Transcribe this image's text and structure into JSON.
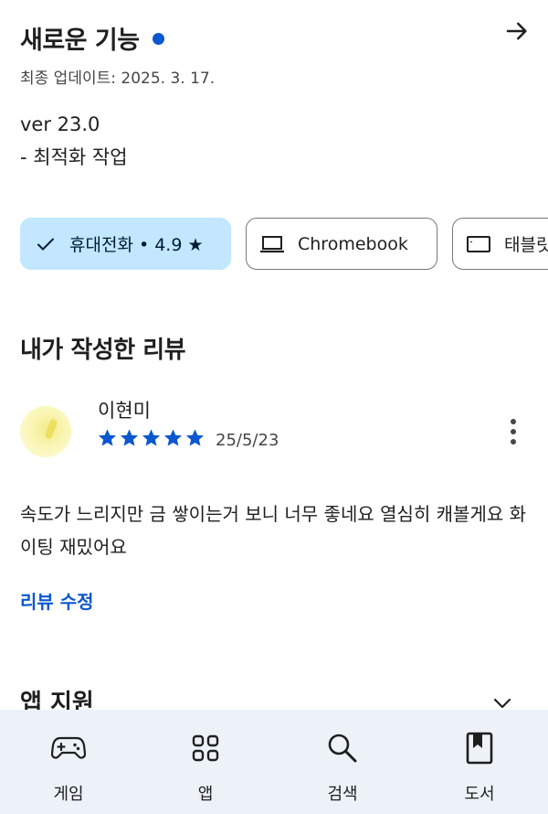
{
  "whats_new": {
    "title": "새로운 기능",
    "updated": "최종 업데이트: 2025. 3. 17.",
    "version": "ver 23.0",
    "note": "- 최적화 작업"
  },
  "device_chips": [
    {
      "label": "휴대전화 • 4.9 ★",
      "icon": "check-icon",
      "selected": true
    },
    {
      "label": "Chromebook",
      "icon": "laptop-icon",
      "selected": false
    },
    {
      "label": "태블릿",
      "icon": "tablet-icon",
      "selected": false
    }
  ],
  "my_review": {
    "section_title": "내가 작성한 리뷰",
    "reviewer": "이현미",
    "rating": 5,
    "date": "25/5/23",
    "text": "속도가 느리지만 금 쌓이는거 보니 너무 좋네요 열심히 캐볼게요 화이팅 재밌어요",
    "edit_label": "리뷰 수정"
  },
  "app_support": {
    "title": "앱 지원"
  },
  "bottom_nav": [
    {
      "label": "게임",
      "icon": "gamepad-icon"
    },
    {
      "label": "앱",
      "icon": "apps-grid-icon"
    },
    {
      "label": "검색",
      "icon": "search-icon"
    },
    {
      "label": "도서",
      "icon": "book-icon"
    }
  ],
  "colors": {
    "accent": "#0b57d0",
    "chip_selected_bg": "#c2e7ff",
    "nav_bg": "#edf2f9"
  }
}
